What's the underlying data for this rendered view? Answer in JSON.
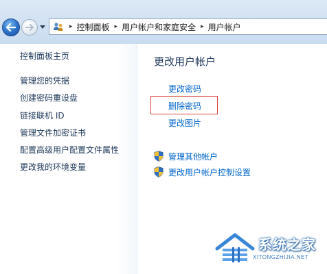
{
  "window": {
    "breadcrumb": [
      "控制面板",
      "用户帐户和家庭安全",
      "用户帐户"
    ],
    "icons": {
      "back": "back-arrow-icon",
      "forward": "forward-arrow-icon",
      "history": "chevron-down-icon",
      "location": "control-panel-users-icon",
      "separator": "chevron-right-icon"
    }
  },
  "sidebar": {
    "home": "控制面板主页",
    "items": [
      {
        "label": "管理您的凭据"
      },
      {
        "label": "创建密码重设盘"
      },
      {
        "label": "链接联机 ID"
      },
      {
        "label": "管理文件加密证书"
      },
      {
        "label": "配置高级用户配置文件属性"
      },
      {
        "label": "更改我的环境变量"
      }
    ]
  },
  "main": {
    "title": "更改用户帐户",
    "tasks": [
      {
        "label": "更改密码"
      },
      {
        "label": "删除密码",
        "highlighted": true
      },
      {
        "label": "更改图片"
      }
    ],
    "shield_tasks": [
      {
        "label": "管理其他帐户",
        "icon": "uac-shield-icon"
      },
      {
        "label": "更改用户帐户控制设置",
        "icon": "uac-shield-icon"
      }
    ]
  },
  "watermark": {
    "title": "系统之家",
    "subtitle": "XITONGZHIJIA.NET"
  },
  "colors": {
    "link": "#0066cc",
    "heading": "#1e395b",
    "highlight_border": "#d9403a",
    "chrome_top": "#dce8f5",
    "chrome_bottom": "#c9dcf0"
  }
}
